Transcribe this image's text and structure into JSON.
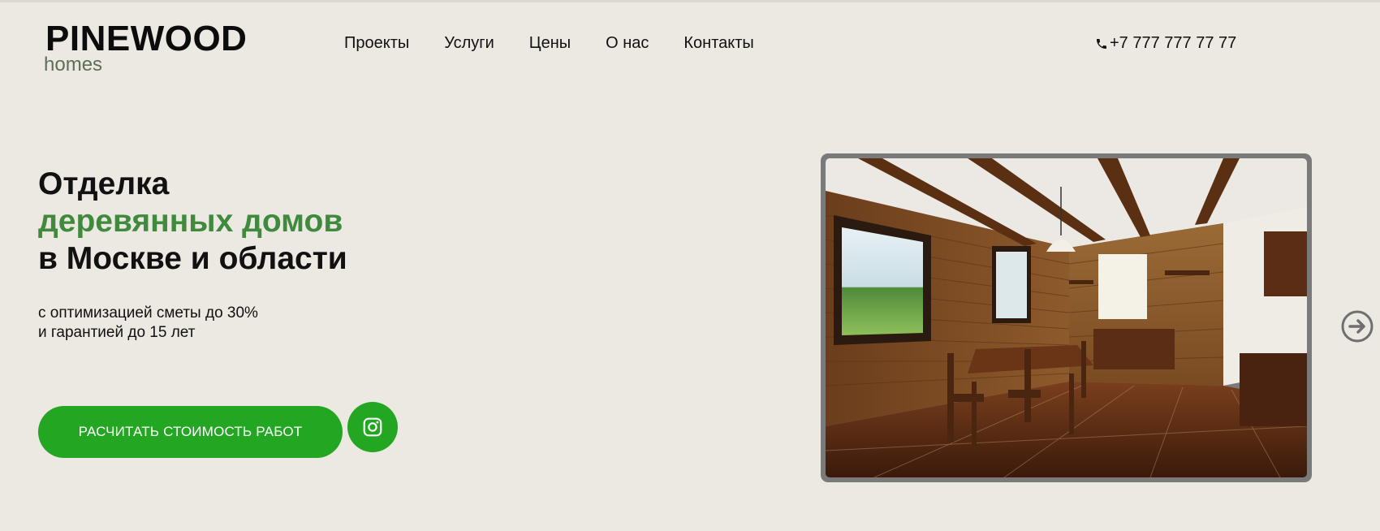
{
  "header": {
    "logo_main": "PINEWOOD",
    "logo_sub": "homes",
    "nav": [
      {
        "label": "Проекты"
      },
      {
        "label": "Услуги"
      },
      {
        "label": "Цены"
      },
      {
        "label": "О нас"
      },
      {
        "label": "Контакты"
      }
    ],
    "phone": "+7 777 777 77 77"
  },
  "hero": {
    "title_line1": "Отделка",
    "title_line2": "деревянных домов",
    "title_line3": "в Москве и области",
    "subtitle_line1": "с оптимизацией сметы до 30%",
    "subtitle_line2": "и гарантией до 15 лет",
    "cta_label": "РАСЧИТАТЬ СТОИМОСТЬ РАБОТ"
  },
  "icons": {
    "phone": "phone-icon",
    "instagram": "instagram-icon",
    "next": "arrow-right-circle-icon"
  },
  "colors": {
    "background": "#ece8e2",
    "accent_green": "#23a622",
    "title_green": "#3f8a3c",
    "logo_sub": "#5e6e58",
    "frame": "#7a7a7a"
  }
}
